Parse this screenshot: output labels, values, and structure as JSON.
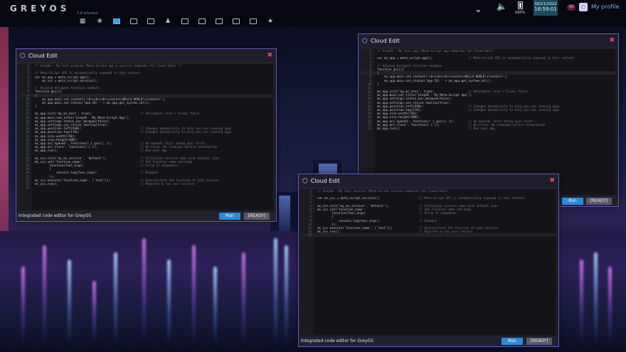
{
  "topbar": {
    "logo": "GREYOS",
    "logo_sub": "3.8 Istanbul",
    "battery_pct": "100%",
    "date": "30/11/2022",
    "time": "16:59:01",
    "profile_badge": "00",
    "profile_label": "My profile"
  },
  "dock": [
    "apps-grid-icon",
    "paw-icon",
    "cloud-edit-icon",
    "folder-icon",
    "terminal-icon",
    "android-icon",
    "window-icon",
    "window-icon",
    "window-icon",
    "window-icon",
    "window-icon",
    "star-icon"
  ],
  "windows": {
    "left": {
      "title": "Cloud Edit",
      "footer": "Integrated code editor for GreyOS",
      "run": "Run",
      "status": "[READY]",
      "lines": [
        [
          "/* GreyOS - My test program (Meta-Script app & service template for Cloud Edit) */",
          ""
        ],
        [
          "",
          ""
        ],
        [
          "// Meta-Script API is automatically exposed in this context",
          ""
        ],
        [
          "var ms_app = meta_script.app();",
          ""
        ],
        [
          "    ms_svc = meta_script.service();",
          ""
        ],
        [
          "",
          ""
        ],
        [
          "// Helping delegate function example",
          ""
        ],
        [
          "function gui(){",
          ""
        ],
        [
          "{",
          ""
        ],
        [
          "    ms_app.main.set_content('<br><br><br><center>HELLO WORLD!</center>');",
          ""
        ],
        [
          "    ms_app.main.set_status('App ID: ' + ms_app.get_system_id());",
          ""
        ],
        [
          "}",
          ""
        ],
        [
          "",
          ""
        ],
        [
          "ms_app.init('my_ms_test', true);",
          "// Resizable: true / Fixed: false"
        ],
        [
          "ms_app.main.set_title('GreyOS - My Meta-Script App');",
          ""
        ],
        [
          "ms_app.settings.status_bar_marquee(false);",
          ""
        ],
        [
          "ms_app.settings.use_resize_tooltip(true);",
          ""
        ],
        [
          "ms_app.position.left(930);",
          "// Changes dynamically to help you use running apps"
        ],
        [
          "ms_app.position.top(170);",
          "// Changes dynamically to help you use running apps"
        ],
        [
          "ms_app.size.width(730);",
          ""
        ],
        [
          "ms_app.size.height(400);",
          ""
        ],
        [
          "ms_app.on('opened', function() { gui(); });",
          "// On-opened: Start doing your stuff..."
        ],
        [
          "ms_app.on('close', function() { });",
          "// On-close: Do cleanups before termination"
        ],
        [
          "ms_app.run();",
          "// Run your app"
        ],
        [
          "",
          ""
        ],
        [
          "ms_svc.init('my_ms_service', 'default');",
          "// Initialize service name with default icon"
        ],
        [
          "ms_svc.set('function_name',",
          "// Set function name and body"
        ],
        [
          "        function(func_args)",
          "// Array of arguments"
        ],
        [
          "        {",
          ""
        ],
        [
          "            console.log(func_args);",
          "// Example"
        ],
        [
          "        });",
          ""
        ],
        [
          "ms_svc.execute('function_name', ['test']);",
          "// Execute/test the function of your service"
        ],
        [
          "ms_svc.run();",
          "// Register & run your service"
        ],
        [
          "",
          ""
        ]
      ]
    },
    "right": {
      "title": "Cloud Edit",
      "run": "Run",
      "status": "[READY]",
      "lines": [
        [
          "// GreyOS - My test app (Meta-Script app template for Cloud Edit)",
          ""
        ],
        [
          "",
          ""
        ],
        [
          "var ms_app = meta_script.app();",
          "// Meta-Script API is automatically exposed in this context"
        ],
        [
          "",
          ""
        ],
        [
          "// Helping delegate function example",
          ""
        ],
        [
          "function gui(){",
          ""
        ],
        [
          "{",
          ""
        ],
        [
          "    ms_app.main.set_content('<br><br><br><center>HELLO WORLD!</center>');",
          ""
        ],
        [
          "    ms_app.main.set_status('App ID: ' + ms_app.get_system_id());",
          ""
        ],
        [
          "}",
          ""
        ],
        [
          "",
          ""
        ],
        [
          "ms_app.init('my_ms_test', true);",
          "// Resizable: true / Fixed: false"
        ],
        [
          "ms_app.main.set_title('GreyOS - My Meta-Script App');",
          ""
        ],
        [
          "ms_app.settings.status_bar_marquee(false);",
          ""
        ],
        [
          "ms_app.settings.use_resize_tooltip(true);",
          ""
        ],
        [
          "ms_app.position.left(930);",
          "// Changes dynamically to help you use running apps"
        ],
        [
          "ms_app.position.top(170);",
          "// Changes dynamically to help you use running apps"
        ],
        [
          "ms_app.size.width(730);",
          ""
        ],
        [
          "ms_app.size.height(400);",
          ""
        ],
        [
          "ms_app.on('opened', function() { gui(); });",
          "// On-opened: Start doing your stuff..."
        ],
        [
          "ms_app.on('close', function() { });",
          "// On-close: Do cleanups before termination"
        ],
        [
          "ms_app.run();",
          "// Run your app"
        ]
      ]
    },
    "bottom": {
      "title": "Cloud Edit",
      "footer": "Integrated code editor for GreyOS",
      "run": "Run",
      "status": "[READY]",
      "lines": [
        [
          "// GreyOS - My test service (Meta-Script service template for Cloud Edit)",
          ""
        ],
        [
          "",
          ""
        ],
        [
          "var ms_svc = meta_script.service();",
          "// Meta-Script API is automatically exposed in this context"
        ],
        [
          "",
          ""
        ],
        [
          "ms_svc.init('my_ms_service', 'default');",
          "// Initialize service name with default icon"
        ],
        [
          "ms_svc.set('function_name',",
          "// Set function name and body"
        ],
        [
          "        function(func_args)",
          "// Array of arguments"
        ],
        [
          "        {",
          ""
        ],
        [
          "            console.log(func_args);",
          "// Example"
        ],
        [
          "        });",
          ""
        ],
        [
          "ms_svc.execute('function_name', ['test']);",
          "// Execute/test the function of your service"
        ],
        [
          "ms_svc.run();",
          "// Register & run your service"
        ],
        [
          "",
          ""
        ]
      ]
    }
  }
}
